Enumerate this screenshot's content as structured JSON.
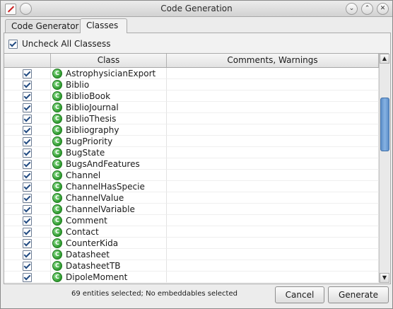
{
  "window": {
    "title": "Code Generation"
  },
  "tabs": [
    {
      "label": "Code Generator"
    },
    {
      "label": "Classes"
    }
  ],
  "uncheck_all": {
    "label": "Uncheck All Classess",
    "checked": true
  },
  "table": {
    "columns": [
      "",
      "Class",
      "Comments, Warnings"
    ],
    "rows": [
      {
        "checked": true,
        "name": "AstrophysicianExport",
        "comment": ""
      },
      {
        "checked": true,
        "name": "Biblio",
        "comment": ""
      },
      {
        "checked": true,
        "name": "BiblioBook",
        "comment": ""
      },
      {
        "checked": true,
        "name": "BiblioJournal",
        "comment": ""
      },
      {
        "checked": true,
        "name": "BiblioThesis",
        "comment": ""
      },
      {
        "checked": true,
        "name": "Bibliography",
        "comment": ""
      },
      {
        "checked": true,
        "name": "BugPriority",
        "comment": ""
      },
      {
        "checked": true,
        "name": "BugState",
        "comment": ""
      },
      {
        "checked": true,
        "name": "BugsAndFeatures",
        "comment": ""
      },
      {
        "checked": true,
        "name": "Channel",
        "comment": ""
      },
      {
        "checked": true,
        "name": "ChannelHasSpecie",
        "comment": ""
      },
      {
        "checked": true,
        "name": "ChannelValue",
        "comment": ""
      },
      {
        "checked": true,
        "name": "ChannelVariable",
        "comment": ""
      },
      {
        "checked": true,
        "name": "Comment",
        "comment": ""
      },
      {
        "checked": true,
        "name": "Contact",
        "comment": ""
      },
      {
        "checked": true,
        "name": "CounterKida",
        "comment": ""
      },
      {
        "checked": true,
        "name": "Datasheet",
        "comment": ""
      },
      {
        "checked": true,
        "name": "DatasheetTB",
        "comment": ""
      },
      {
        "checked": true,
        "name": "DipoleMoment",
        "comment": ""
      }
    ]
  },
  "status": "69 entities selected; No embeddables selected",
  "buttons": {
    "cancel": "Cancel",
    "generate": "Generate"
  }
}
